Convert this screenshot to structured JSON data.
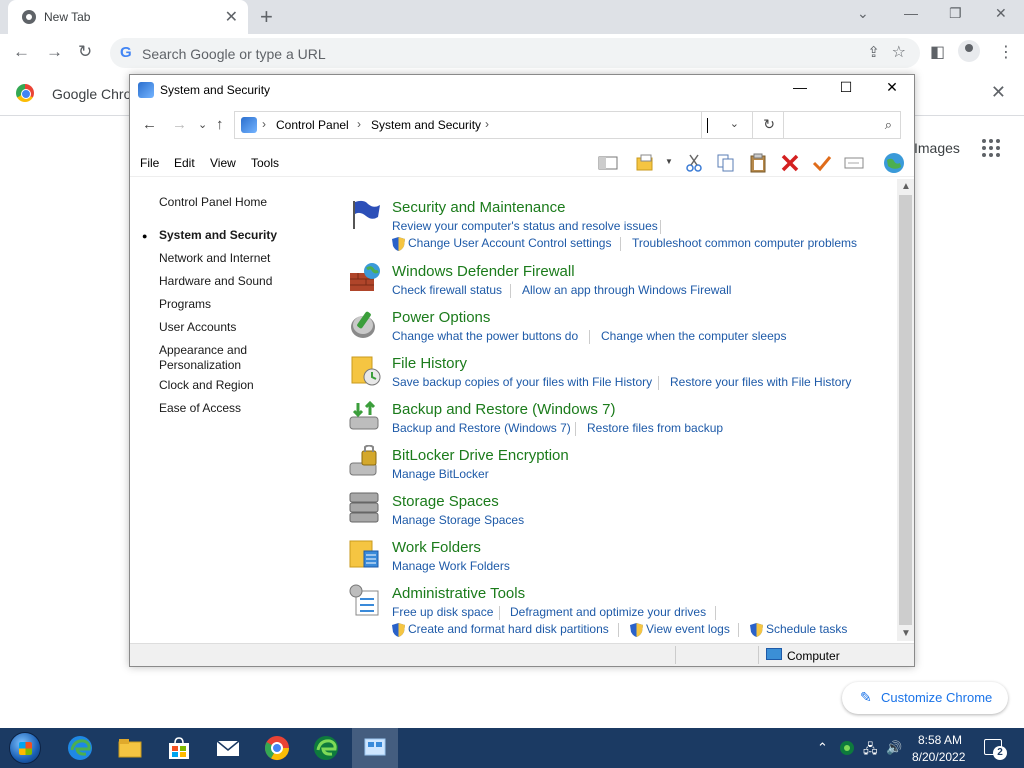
{
  "chrome": {
    "tab_title": "New Tab",
    "omnibox_placeholder": "Search Google or type a URL",
    "infobar_text": "Google Chrome",
    "ntp_images_link": "Images",
    "customize_label": "Customize Chrome"
  },
  "window": {
    "title": "System and Security",
    "breadcrumb": [
      "Control Panel",
      "System and Security"
    ],
    "search_value": "",
    "menu": [
      "File",
      "Edit",
      "View",
      "Tools"
    ]
  },
  "sidebar": {
    "items": [
      {
        "label": "Control Panel Home"
      },
      {
        "label": "System and Security",
        "current": true
      },
      {
        "label": "Network and Internet"
      },
      {
        "label": "Hardware and Sound"
      },
      {
        "label": "Programs"
      },
      {
        "label": "User Accounts"
      },
      {
        "label": "Appearance and Personalization"
      },
      {
        "label": "Clock and Region"
      },
      {
        "label": "Ease of Access"
      }
    ]
  },
  "categories": [
    {
      "title": "Security and Maintenance",
      "icon": "flag-icon",
      "links": [
        "Review your computer's status and resolve issues",
        "Change User Account Control settings",
        "Troubleshoot common computer problems"
      ]
    },
    {
      "title": "Windows Defender Firewall",
      "icon": "firewall-icon",
      "links": [
        "Check firewall status",
        "Allow an app through Windows Firewall"
      ]
    },
    {
      "title": "Power Options",
      "icon": "power-icon",
      "links": [
        "Change what the power buttons do",
        "Change when the computer sleeps"
      ]
    },
    {
      "title": "File History",
      "icon": "file-history-icon",
      "links": [
        "Save backup copies of your files with File History",
        "Restore your files with File History"
      ]
    },
    {
      "title": "Backup and Restore (Windows 7)",
      "icon": "backup-icon",
      "links": [
        "Backup and Restore (Windows 7)",
        "Restore files from backup"
      ]
    },
    {
      "title": "BitLocker Drive Encryption",
      "icon": "bitlocker-icon",
      "links": [
        "Manage BitLocker"
      ]
    },
    {
      "title": "Storage Spaces",
      "icon": "storage-spaces-icon",
      "links": [
        "Manage Storage Spaces"
      ]
    },
    {
      "title": "Work Folders",
      "icon": "work-folders-icon",
      "links": [
        "Manage Work Folders"
      ]
    },
    {
      "title": "Administrative Tools",
      "icon": "admin-tools-icon",
      "links": [
        "Free up disk space",
        "Defragment and optimize your drives",
        "Create and format hard disk partitions",
        "View event logs",
        "Schedule tasks"
      ]
    }
  ],
  "status": {
    "computer_label": "Computer"
  },
  "taskbar": {
    "time": "8:58 AM",
    "date": "8/20/2022",
    "notification_count": "2"
  },
  "colors": {
    "category_title": "#1b7b1b",
    "link": "#1e5aa8",
    "taskbar": "#1b3a63"
  }
}
